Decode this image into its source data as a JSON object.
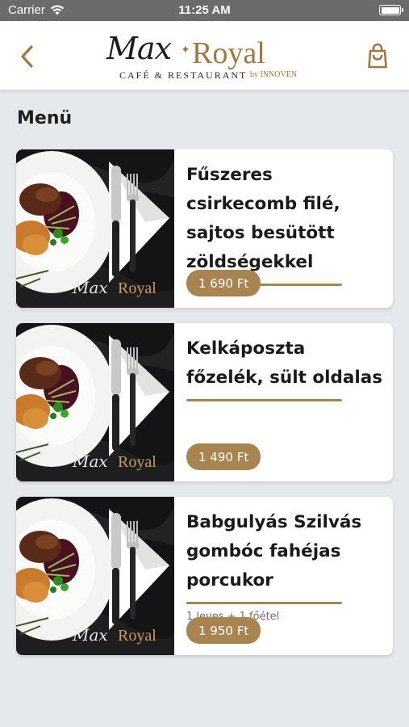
{
  "status_bar": {
    "carrier": "Carrier",
    "time": "11:25 AM"
  },
  "header": {
    "logo_max": "Max",
    "logo_royal": "Royal",
    "logo_subtitle": "CAFÉ & RESTAURANT",
    "logo_by": "by INNOVEN",
    "accent_color": "#a88550"
  },
  "main": {
    "title": "Menü",
    "items": [
      {
        "name": "Fűszeres csirkecomb filé, sajtos besütött zöldségekkel",
        "description": "",
        "price": "1 690 Ft"
      },
      {
        "name": "Kelkáposzta főzelék, sült oldalas",
        "description": "",
        "price": "1 490 Ft"
      },
      {
        "name": "Babgulyás Szilvás gombóc fahéjas porcukor",
        "description": "1 leves + 1 főétel",
        "price": "1 950 Ft"
      }
    ],
    "thumbnail_logo_max": "Max",
    "thumbnail_logo_royal": "Royal"
  },
  "icons": {
    "back": "chevron-left-icon",
    "cart": "shopping-bag-icon",
    "wifi": "wifi-icon",
    "battery": "battery-icon"
  }
}
